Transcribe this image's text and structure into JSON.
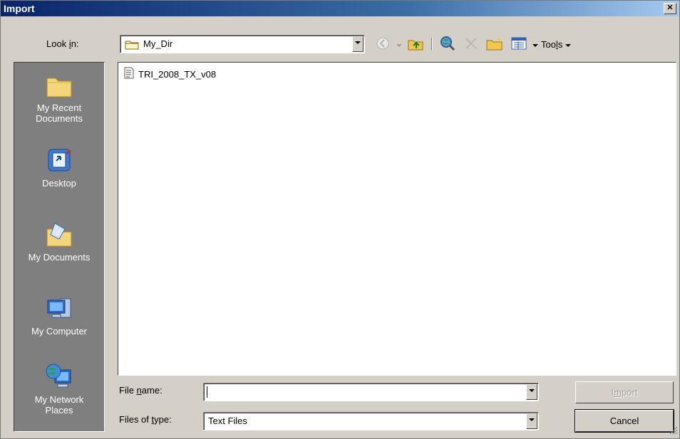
{
  "dialog": {
    "title": "Import",
    "close_label": "✕"
  },
  "look_in": {
    "label_pre": "Look ",
    "label_u": "i",
    "label_post": "n:",
    "value": "My_Dir"
  },
  "toolbar": {
    "tools_label": "Tools",
    "tools_label_pre": "Too",
    "tools_label_u": "l",
    "tools_label_post": "s"
  },
  "places": [
    {
      "label": "My Recent Documents",
      "icon": "recent-folder-icon"
    },
    {
      "label": "Desktop",
      "icon": "desktop-icon"
    },
    {
      "label": "My Documents",
      "icon": "my-documents-icon"
    },
    {
      "label": "My Computer",
      "icon": "my-computer-icon"
    },
    {
      "label": "My Network Places",
      "icon": "network-places-icon"
    }
  ],
  "files": [
    {
      "name": "TRI_2008_TX_v08",
      "icon": "text-file-icon"
    }
  ],
  "file_name": {
    "label_pre": "File ",
    "label_u": "n",
    "label_post": "ame:",
    "value": ""
  },
  "file_type": {
    "label_pre": "Files of ",
    "label_u": "t",
    "label_post": "ype:",
    "value": "Text Files"
  },
  "buttons": {
    "import_pre": "I",
    "import_u": "m",
    "import_post": "port",
    "cancel": "Cancel"
  },
  "colors": {
    "title_bar_start": "#0a246a",
    "dialog_face": "#d4d0c8",
    "places_bar": "#7f7f7f"
  }
}
